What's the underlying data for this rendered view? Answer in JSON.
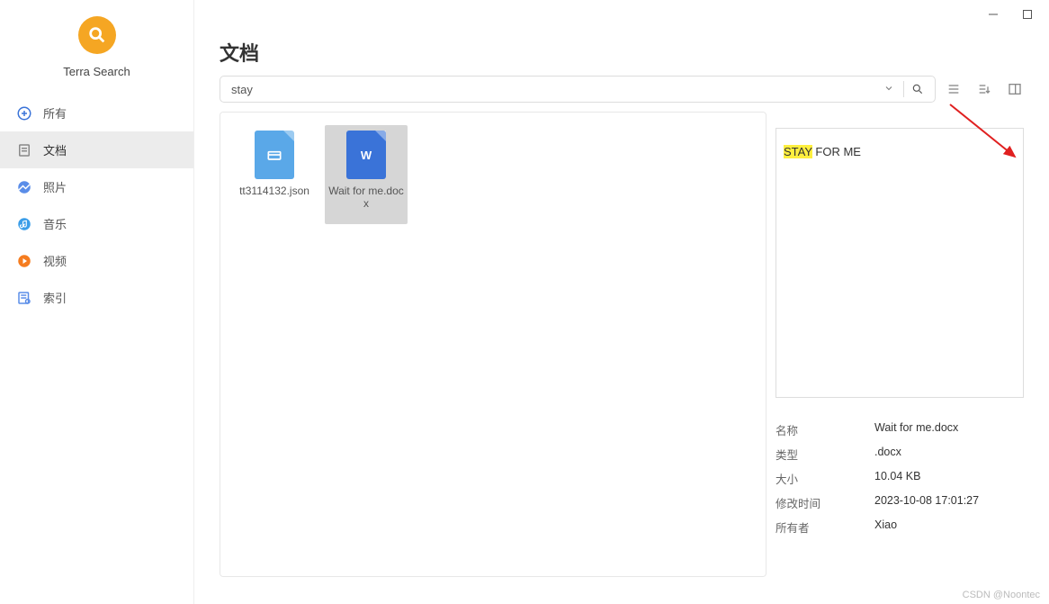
{
  "app": {
    "name": "Terra Search"
  },
  "heading": "文档",
  "search": {
    "value": "stay"
  },
  "sidebar": {
    "items": [
      {
        "label": "所有"
      },
      {
        "label": "文档"
      },
      {
        "label": "照片"
      },
      {
        "label": "音乐"
      },
      {
        "label": "视频"
      },
      {
        "label": "索引"
      }
    ]
  },
  "files": [
    {
      "name": "tt3114132.json"
    },
    {
      "name": "Wait for me.docx"
    }
  ],
  "preview": {
    "highlight": "STAY",
    "rest": " FOR ME"
  },
  "details": {
    "labels": {
      "name": "名称",
      "type": "类型",
      "size": "大小",
      "modified": "修改时间",
      "owner": "所有者"
    },
    "values": {
      "name": "Wait for me.docx",
      "type": ".docx",
      "size": "10.04 KB",
      "modified": "2023-10-08 17:01:27",
      "owner": "Xiao"
    }
  },
  "watermark": "CSDN @Noontec"
}
